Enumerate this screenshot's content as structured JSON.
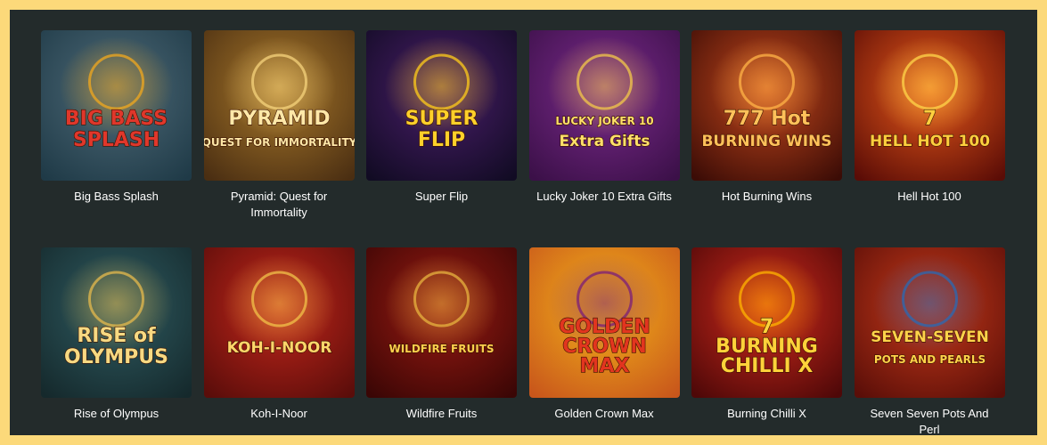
{
  "games": [
    {
      "title": "Big Bass Splash",
      "logo_lines": [
        "BIG BASS",
        "SPLASH"
      ],
      "colors": {
        "bg1": "#4e6a78",
        "bg2": "#1f3a47",
        "accent": "#f2a81d",
        "text": "#e0372b"
      }
    },
    {
      "title": "Pyramid: Quest for Immortality",
      "logo_lines": [
        "PYRAMID",
        "QUEST FOR IMMORTALITY"
      ],
      "colors": {
        "bg1": "#a8782a",
        "bg2": "#4a2e12",
        "accent": "#f6d37c",
        "text": "#ffe8a8"
      }
    },
    {
      "title": "Super Flip",
      "logo_lines": [
        "SUPER",
        "FLIP"
      ],
      "colors": {
        "bg1": "#4a1e6a",
        "bg2": "#110b23",
        "accent": "#ffcc1a",
        "text": "#ffd02a"
      }
    },
    {
      "title": "Lucky Joker 10 Extra Gifts",
      "logo_lines": [
        "LUCKY JOKER 10",
        "Extra Gifts"
      ],
      "colors": {
        "bg1": "#7b2a8c",
        "bg2": "#3b1048",
        "accent": "#f3c84a",
        "text": "#ffe06a"
      }
    },
    {
      "title": "Hot Burning Wins",
      "logo_lines": [
        "777 Hot",
        "BURNING WINS"
      ],
      "colors": {
        "bg1": "#c4471c",
        "bg2": "#3b0c06",
        "accent": "#ffb347",
        "text": "#ffc15a"
      }
    },
    {
      "title": "Hell Hot 100",
      "logo_lines": [
        "7",
        "HELL HOT 100"
      ],
      "colors": {
        "bg1": "#e8591a",
        "bg2": "#5a0c06",
        "accent": "#ffd54a",
        "text": "#ffcf3e"
      }
    },
    {
      "title": "Rise of Olympus",
      "logo_lines": [
        "RISE of",
        "OLYMPUS"
      ],
      "colors": {
        "bg1": "#2f5c62",
        "bg2": "#15292c",
        "accent": "#e6b94c",
        "text": "#f7d982"
      }
    },
    {
      "title": "Koh-I-Noor",
      "logo_lines": [
        "KOH-I-NOOR"
      ],
      "colors": {
        "bg1": "#c3261b",
        "bg2": "#5a0d0a",
        "accent": "#f2c24a",
        "text": "#ffd66a"
      }
    },
    {
      "title": "Wildfire Fruits",
      "logo_lines": [
        "WILDFIRE FRUITS"
      ],
      "colors": {
        "bg1": "#9a1a12",
        "bg2": "#3a0605",
        "accent": "#e7b33f",
        "text": "#ffd04d"
      }
    },
    {
      "title": "Golden Crown Max",
      "logo_lines": [
        "GOLDEN",
        "CROWN",
        "MAX"
      ],
      "colors": {
        "bg1": "#f3b21a",
        "bg2": "#c8561b",
        "accent": "#7b1e7a",
        "text": "#e2351f"
      }
    },
    {
      "title": "Burning Chilli X",
      "logo_lines": [
        "7",
        "BURNING",
        "CHILLI X"
      ],
      "colors": {
        "bg1": "#d02a1c",
        "bg2": "#4e0808",
        "accent": "#ffb400",
        "text": "#ffd23a"
      }
    },
    {
      "title": "Seven Seven Pots And Perl",
      "logo_lines": [
        "SEVEN-SEVEN",
        "POTS AND PEARLS"
      ],
      "colors": {
        "bg1": "#c73a1a",
        "bg2": "#5a0e08",
        "accent": "#2a6ab4",
        "text": "#ffd34a"
      }
    }
  ]
}
